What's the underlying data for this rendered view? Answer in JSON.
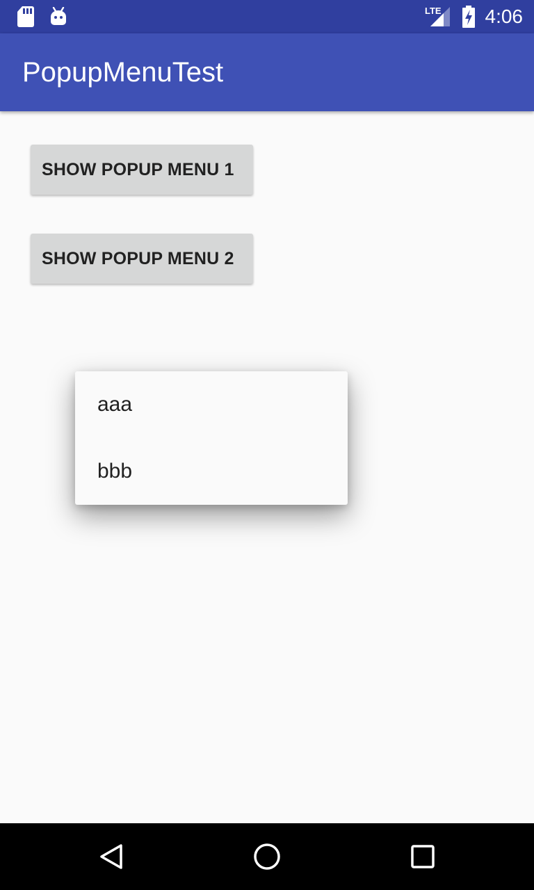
{
  "status_bar": {
    "time": "4:06",
    "network_label": "LTE",
    "icons": [
      "sd-card-icon",
      "android-debug-icon",
      "lte-signal-icon",
      "battery-charging-icon"
    ]
  },
  "app_bar": {
    "title": "PopupMenuTest"
  },
  "buttons": [
    {
      "label": "SHOW POPUP MENU 1"
    },
    {
      "label": "SHOW POPUP MENU 2"
    }
  ],
  "popup_menu": {
    "items": [
      {
        "label": "aaa"
      },
      {
        "label": "bbb"
      }
    ]
  },
  "nav_bar": {
    "icons": [
      "back-icon",
      "home-icon",
      "recents-icon"
    ]
  },
  "colors": {
    "status_bar": "#303f9f",
    "app_bar": "#3f51b5",
    "background": "#fafafa",
    "button": "#d6d7d7",
    "nav_bar": "#000000"
  }
}
